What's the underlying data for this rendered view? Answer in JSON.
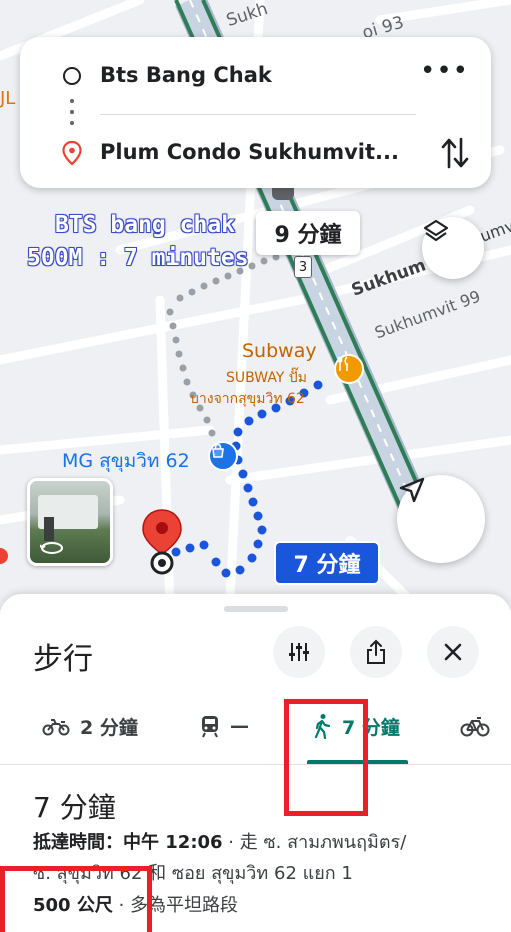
{
  "route": {
    "origin": "Bts Bang Chak",
    "destination": "Plum Condo Sukhumvit..."
  },
  "map": {
    "street_labels": {
      "top": "Sukh",
      "soi93": "oi 93",
      "sukhumvit_ail": "Sukhumvit Ail",
      "sukhum": "Sukhum",
      "sukhumvit99": "Sukhumvit 99",
      "left_fragment": "JL"
    },
    "poi": {
      "subway_name": "Subway",
      "subway_sub": "SUBWAY ปั๊ม",
      "subway_sub2": "บางจากสุขุมวิท 62",
      "mg_name": "MG สุขุมวิท 62"
    },
    "route_shield": "3",
    "annotation_line1": "BTS bang chak",
    "annotation_line2": "500M : 7 minutes",
    "alt_route_time": "9 分鐘",
    "main_route_time": "7 分鐘"
  },
  "sheet": {
    "title": "步行",
    "modes": [
      {
        "icon": "motorcycle-icon",
        "label": "2 分鐘"
      },
      {
        "icon": "train-icon",
        "label": "—"
      },
      {
        "icon": "walk-icon",
        "label": "7 分鐘"
      },
      {
        "icon": "bicycle-icon",
        "label": ""
      }
    ],
    "duration": "7 分鐘",
    "arrival_label": "抵達時間：中午 12:06",
    "via_text": " · 走 ซ. สามภพนฤมิตร/",
    "via_text2": "ซ. สุขุมวิท 62 和 ซอย สุขุมวิท 62 แยก 1",
    "distance": "500 公尺",
    "terrain": " · 多為平坦路段"
  },
  "colors": {
    "route_blue": "#1a56db",
    "accent_teal": "#00796b",
    "highlight_red": "#e8202a",
    "poi_orange": "#e37400"
  }
}
